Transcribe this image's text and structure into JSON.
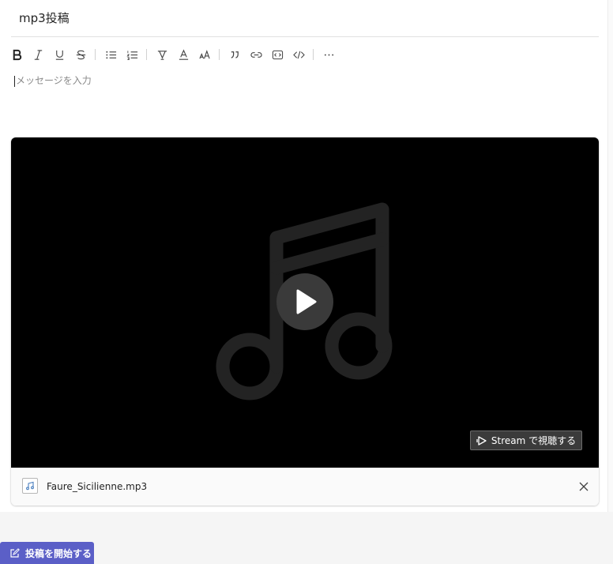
{
  "compose": {
    "subject": "mp3投稿",
    "editor_placeholder": "メッセージを入力",
    "toolbar": [
      {
        "name": "bold-button",
        "icon": "bold-icon"
      },
      {
        "name": "italic-button",
        "icon": "italic-icon"
      },
      {
        "name": "underline-button",
        "icon": "underline-icon"
      },
      {
        "name": "strikethrough-button",
        "icon": "strikethrough-icon"
      },
      {
        "name": "bulleted-list-button",
        "icon": "bulleted-list-icon"
      },
      {
        "name": "numbered-list-button",
        "icon": "numbered-list-icon"
      },
      {
        "name": "highlight-button",
        "icon": "highlight-icon"
      },
      {
        "name": "font-color-button",
        "icon": "font-color-icon"
      },
      {
        "name": "font-size-button",
        "icon": "font-size-icon"
      },
      {
        "name": "quote-button",
        "icon": "quote-icon"
      },
      {
        "name": "link-button",
        "icon": "link-icon"
      },
      {
        "name": "code-snippet-button",
        "icon": "code-snippet-icon"
      },
      {
        "name": "code-button",
        "icon": "code-icon"
      },
      {
        "name": "more-options-button",
        "icon": "ellipsis-icon"
      }
    ]
  },
  "attachment": {
    "player_icon": "music-note-icon",
    "stream_button_label": "Stream で視聴する",
    "file_name": "Faure_Sicilienne.mp3",
    "file_icon": "audio-file-icon"
  },
  "footer": {
    "start_post_label": "投稿を開始する"
  },
  "colors": {
    "accent": "#5b5fc7",
    "player_background": "#000000"
  }
}
